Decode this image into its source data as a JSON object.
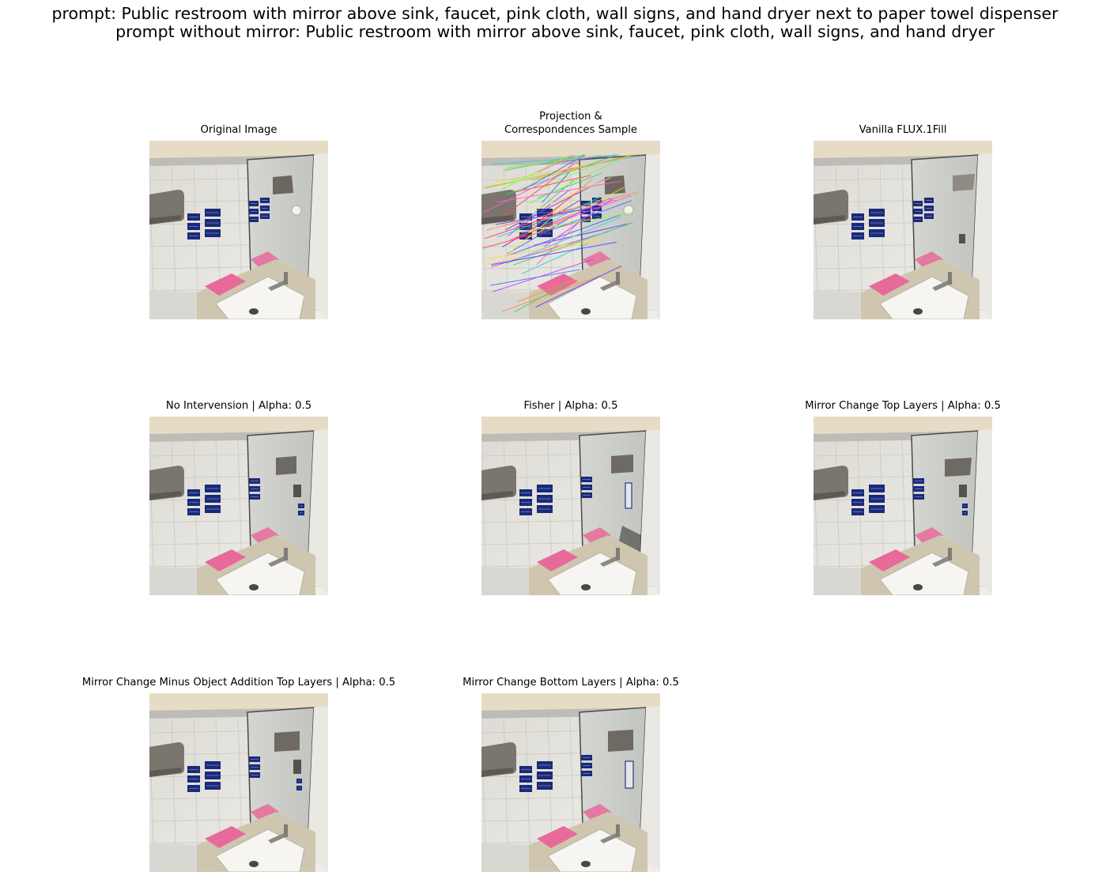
{
  "suptitle": {
    "line1": "prompt: Public restroom with mirror above sink, faucet, pink cloth, wall signs, and hand dryer next to paper towel dispenser",
    "line2": "prompt without mirror: Public restroom with mirror above sink, faucet, pink cloth, wall signs, and hand dryer"
  },
  "panels": [
    {
      "title_lines": [
        "Original Image"
      ],
      "variant": "original"
    },
    {
      "title_lines": [
        "Projection &",
        "Correspondences Sample"
      ],
      "variant": "correspondences"
    },
    {
      "title_lines": [
        "Vanilla FLUX.1Fill"
      ],
      "variant": "vanilla"
    },
    {
      "title_lines": [
        "No Intervension | Alpha: 0.5"
      ],
      "variant": "nointervention"
    },
    {
      "title_lines": [
        "Fisher | Alpha: 0.5"
      ],
      "variant": "fisher"
    },
    {
      "title_lines": [
        "Mirror Change Top Layers | Alpha: 0.5"
      ],
      "variant": "mirrortop"
    },
    {
      "title_lines": [
        "Mirror Change Minus Object Addition Top Layers | Alpha: 0.5"
      ],
      "variant": "minusobj"
    },
    {
      "title_lines": [
        "Mirror Change Bottom Layers | Alpha: 0.5"
      ],
      "variant": "mirrorbottom"
    }
  ],
  "colors": {
    "wall": "#e4e3de",
    "tile_line": "#c9c8c2",
    "sign": "#1a2a7a",
    "cloth": "#e86a9a",
    "counter": "#cfc6b0",
    "dryer": "#7a756d"
  }
}
